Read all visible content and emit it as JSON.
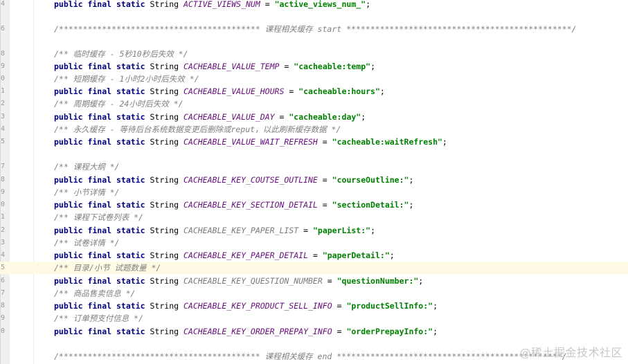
{
  "lines": {
    "l4": {
      "no": "4",
      "kw": "public final static",
      "type": "String",
      "name": "ACTIVE_VIEWS_NUM",
      "eq": "=",
      "value": "\"active_views_num_\"",
      "end": ";"
    },
    "l6": {
      "no": "6",
      "text": "/****************************************** 课程相关缓存 start ***********************************************/"
    },
    "l8": {
      "no": "8",
      "comment": "/** 临时缓存 - 5秒10秒后失效 */"
    },
    "l9": {
      "no": "9",
      "kw": "public final static",
      "type": "String",
      "name": "CACHEABLE_VALUE_TEMP",
      "eq": "=",
      "value": "\"cacheable:temp\"",
      "end": ";"
    },
    "l10": {
      "no": "0",
      "comment": "/** 短期缓存 - 1小时2小时后失效 */"
    },
    "l11": {
      "no": "1",
      "kw": "public final static",
      "type": "String",
      "name": "CACHEABLE_VALUE_HOURS",
      "eq": "=",
      "value": "\"cacheable:hours\"",
      "end": ";"
    },
    "l12": {
      "no": "2",
      "comment": "/** 周期缓存 - 24小时后失效 */"
    },
    "l13": {
      "no": "3",
      "kw": "public final static",
      "type": "String",
      "name": "CACHEABLE_VALUE_DAY",
      "eq": "=",
      "value": "\"cacheable:day\"",
      "end": ";"
    },
    "l14": {
      "no": "4",
      "comment": "/** 永久缓存 - 等待后台系统数据变更后删除或reput，以此刷新缓存数据 */"
    },
    "l15": {
      "no": "5",
      "kw": "public final static",
      "type": "String",
      "name": "CACHEABLE_VALUE_WAIT_REFRESH",
      "eq": "=",
      "value": "\"cacheable:waitRefresh\"",
      "end": ";"
    },
    "l17": {
      "no": "7",
      "comment": "/** 课程大纲 */"
    },
    "l18": {
      "no": "8",
      "kw": "public final static",
      "type": "String",
      "name": "CACHEABLE_KEY_COUTSE_OUTLINE",
      "eq": "=",
      "value": "\"courseOutline:\"",
      "end": ";"
    },
    "l19": {
      "no": "9",
      "comment": "/** 小节详情 */"
    },
    "l20": {
      "no": "0",
      "kw": "public final static",
      "type": "String",
      "name": "CACHEABLE_KEY_SECTION_DETAIL",
      "eq": "=",
      "value": "\"sectionDetail:\"",
      "end": ";"
    },
    "l21": {
      "no": "1",
      "comment": "/** 课程下试卷列表 */"
    },
    "l22": {
      "no": "2",
      "kw": "public final static",
      "type": "String",
      "name": "CACHEABLE_KEY_PAPER_LIST",
      "eq": "=",
      "value": "\"paperList:\"",
      "end": ";"
    },
    "l23": {
      "no": "3",
      "comment": "/** 试卷详情 */"
    },
    "l24": {
      "no": "4",
      "kw": "public final static",
      "type": "String",
      "name": "CACHEABLE_KEY_PAPER_DETAIL",
      "eq": "=",
      "value": "\"paperDetail:\"",
      "end": ";"
    },
    "l25": {
      "no": "5",
      "comment": "/** 目录/小节 试题数量 */"
    },
    "l26": {
      "no": "6",
      "kw": "public final static",
      "type": "String",
      "name": "CACHEABLE_KEY_QUESTION_NUMBER",
      "eq": "=",
      "value": "\"questionNumber:\"",
      "end": ";"
    },
    "l27": {
      "no": "7",
      "comment": "/** 商品售卖信息 */"
    },
    "l28": {
      "no": "8",
      "kw": "public final static",
      "type": "String",
      "name": "CACHEABLE_KEY_PRODUCT_SELL_INFO",
      "eq": "=",
      "value": "\"productSellInfo:\"",
      "end": ";"
    },
    "l29": {
      "no": "9",
      "comment": "/** 订单预支付信息 */"
    },
    "l30": {
      "no": "0",
      "kw": "public final static",
      "type": "String",
      "name": "CACHEABLE_KEY_ORDER_PREPAY_INFO",
      "eq": "=",
      "value": "\"orderPrepayInfo:\"",
      "end": ";"
    },
    "l32": {
      "no": "",
      "text": "/****************************************** 课程相关缓存 end ***********************************************/"
    }
  },
  "watermark": "@稀土掘金技术社区",
  "colors": {
    "keyword": "#000080",
    "constant": "#660e7a",
    "string": "#008000",
    "comment": "#808080",
    "highlight": "#fffae3"
  }
}
